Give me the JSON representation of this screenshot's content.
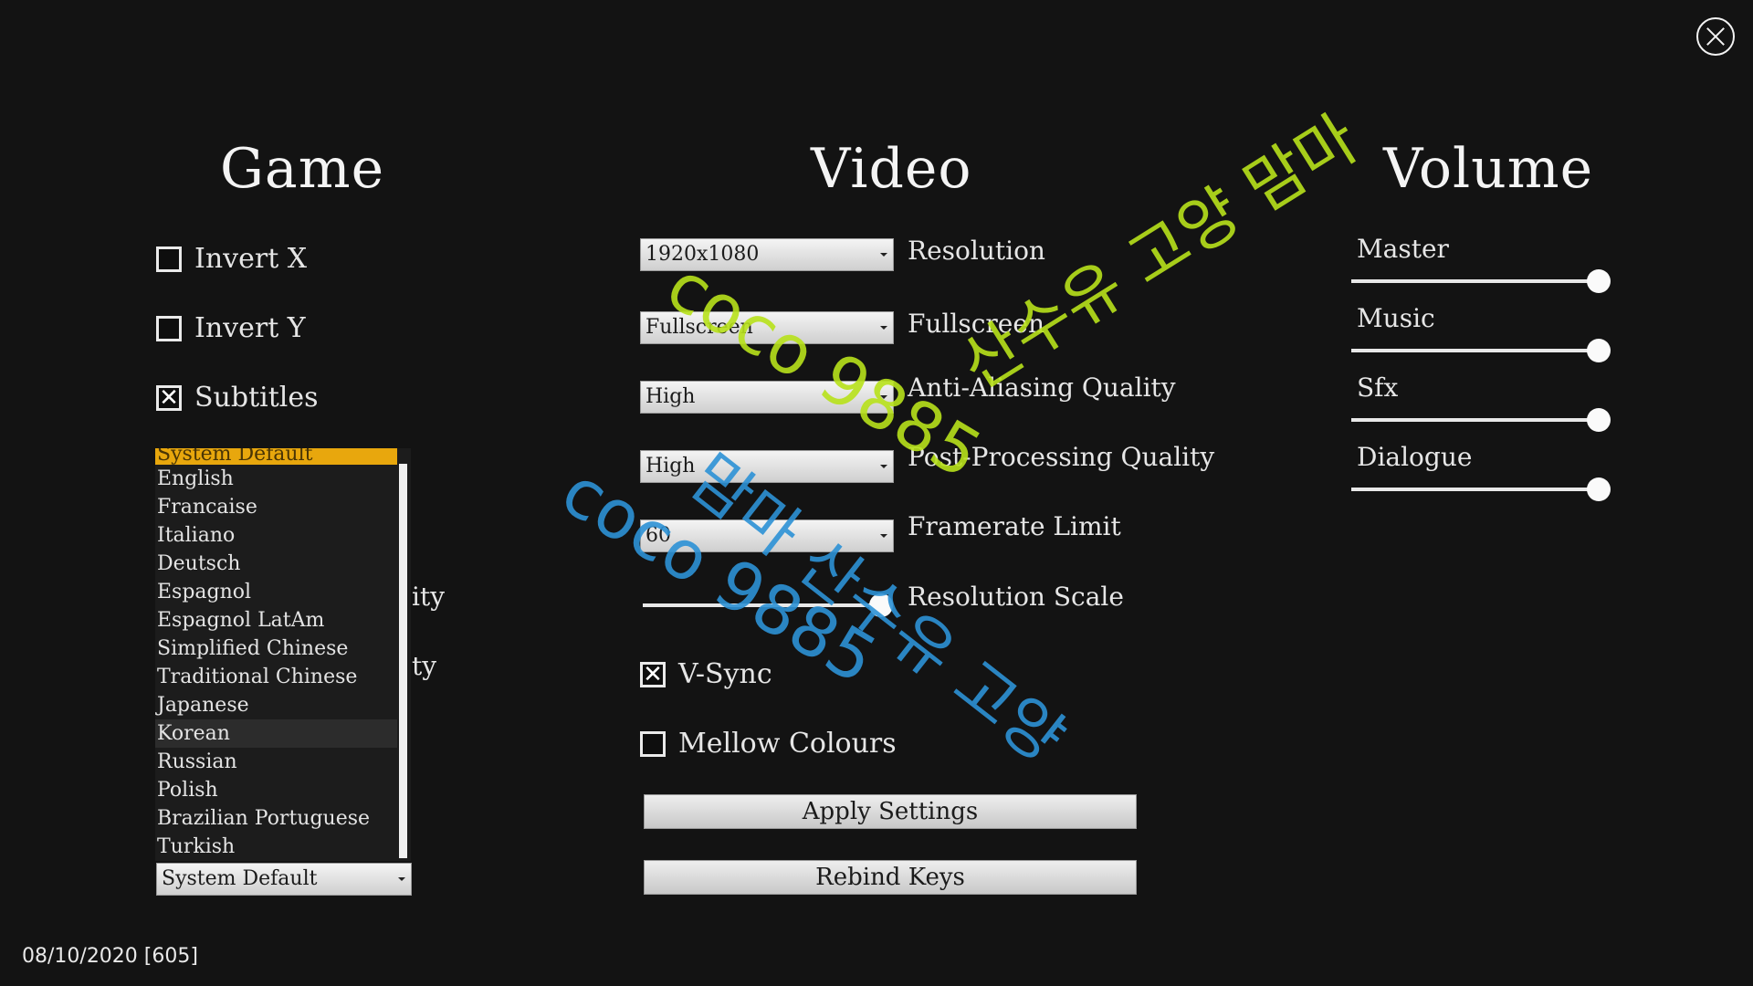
{
  "close_icon": "close-circle-x-icon",
  "sections": {
    "game": "Game",
    "video": "Video",
    "volume": "Volume"
  },
  "game": {
    "invert_x": {
      "label": "Invert X",
      "checked": false
    },
    "invert_y": {
      "label": "Invert Y",
      "checked": false
    },
    "subtitles": {
      "label": "Subtitles",
      "checked": true
    },
    "language_dropdown": {
      "selected": "System Default",
      "options": [
        "System Default",
        "English",
        "Francaise",
        "Italiano",
        "Deutsch",
        "Espagnol",
        "Espagnol LatAm",
        "Simplified Chinese",
        "Traditional Chinese",
        "Japanese",
        "Korean",
        "Russian",
        "Polish",
        "Brazilian Portuguese",
        "Turkish"
      ],
      "hovered": "Korean"
    },
    "obscured_labels": [
      "ity",
      "ty"
    ]
  },
  "video": {
    "resolution": {
      "value": "1920x1080",
      "label": "Resolution"
    },
    "fullscreen": {
      "value": "Fullscreen",
      "label": "Fullscreen"
    },
    "anti_aliasing": {
      "value": "High",
      "label": "Anti-Aliasing Quality"
    },
    "post_processing": {
      "value": "High",
      "label": "Post-Processing Quality"
    },
    "framerate": {
      "value": "60",
      "label": "Framerate Limit"
    },
    "resolution_scale": {
      "label": "Resolution Scale",
      "value_fraction": 1.0
    },
    "vsync": {
      "label": "V-Sync",
      "checked": true
    },
    "mellow_colours": {
      "label": "Mellow Colours",
      "checked": false
    },
    "apply_button": "Apply Settings",
    "rebind_button": "Rebind Keys"
  },
  "volume": {
    "master": {
      "label": "Master",
      "value_fraction": 1.0
    },
    "music": {
      "label": "Music",
      "value_fraction": 1.0
    },
    "sfx": {
      "label": "Sfx",
      "value_fraction": 1.0
    },
    "dialogue": {
      "label": "Dialogue",
      "value_fraction": 1.0
    }
  },
  "footer": "08/10/2020  [605]",
  "watermarks": {
    "green_line1": "coco 9885",
    "green_line2": "산수유 고양 맘마",
    "blue_line1": "coco 9885",
    "blue_line2": "맘마 산수유 고양"
  },
  "colors": {
    "background": "#131313",
    "selected_option": "#e8a70d",
    "watermark_green": "#b8e21b",
    "watermark_blue": "#2d92d6"
  }
}
